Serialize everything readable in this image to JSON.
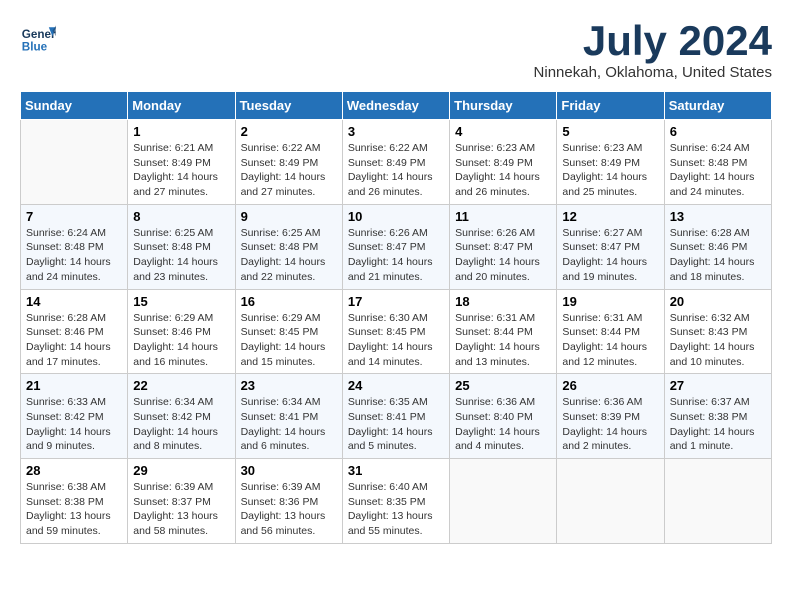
{
  "header": {
    "logo_line1": "General",
    "logo_line2": "Blue",
    "month": "July 2024",
    "location": "Ninnekah, Oklahoma, United States"
  },
  "weekdays": [
    "Sunday",
    "Monday",
    "Tuesday",
    "Wednesday",
    "Thursday",
    "Friday",
    "Saturday"
  ],
  "weeks": [
    [
      {
        "day": "",
        "info": ""
      },
      {
        "day": "1",
        "info": "Sunrise: 6:21 AM\nSunset: 8:49 PM\nDaylight: 14 hours\nand 27 minutes."
      },
      {
        "day": "2",
        "info": "Sunrise: 6:22 AM\nSunset: 8:49 PM\nDaylight: 14 hours\nand 27 minutes."
      },
      {
        "day": "3",
        "info": "Sunrise: 6:22 AM\nSunset: 8:49 PM\nDaylight: 14 hours\nand 26 minutes."
      },
      {
        "day": "4",
        "info": "Sunrise: 6:23 AM\nSunset: 8:49 PM\nDaylight: 14 hours\nand 26 minutes."
      },
      {
        "day": "5",
        "info": "Sunrise: 6:23 AM\nSunset: 8:49 PM\nDaylight: 14 hours\nand 25 minutes."
      },
      {
        "day": "6",
        "info": "Sunrise: 6:24 AM\nSunset: 8:48 PM\nDaylight: 14 hours\nand 24 minutes."
      }
    ],
    [
      {
        "day": "7",
        "info": "Sunrise: 6:24 AM\nSunset: 8:48 PM\nDaylight: 14 hours\nand 24 minutes."
      },
      {
        "day": "8",
        "info": "Sunrise: 6:25 AM\nSunset: 8:48 PM\nDaylight: 14 hours\nand 23 minutes."
      },
      {
        "day": "9",
        "info": "Sunrise: 6:25 AM\nSunset: 8:48 PM\nDaylight: 14 hours\nand 22 minutes."
      },
      {
        "day": "10",
        "info": "Sunrise: 6:26 AM\nSunset: 8:47 PM\nDaylight: 14 hours\nand 21 minutes."
      },
      {
        "day": "11",
        "info": "Sunrise: 6:26 AM\nSunset: 8:47 PM\nDaylight: 14 hours\nand 20 minutes."
      },
      {
        "day": "12",
        "info": "Sunrise: 6:27 AM\nSunset: 8:47 PM\nDaylight: 14 hours\nand 19 minutes."
      },
      {
        "day": "13",
        "info": "Sunrise: 6:28 AM\nSunset: 8:46 PM\nDaylight: 14 hours\nand 18 minutes."
      }
    ],
    [
      {
        "day": "14",
        "info": "Sunrise: 6:28 AM\nSunset: 8:46 PM\nDaylight: 14 hours\nand 17 minutes."
      },
      {
        "day": "15",
        "info": "Sunrise: 6:29 AM\nSunset: 8:46 PM\nDaylight: 14 hours\nand 16 minutes."
      },
      {
        "day": "16",
        "info": "Sunrise: 6:29 AM\nSunset: 8:45 PM\nDaylight: 14 hours\nand 15 minutes."
      },
      {
        "day": "17",
        "info": "Sunrise: 6:30 AM\nSunset: 8:45 PM\nDaylight: 14 hours\nand 14 minutes."
      },
      {
        "day": "18",
        "info": "Sunrise: 6:31 AM\nSunset: 8:44 PM\nDaylight: 14 hours\nand 13 minutes."
      },
      {
        "day": "19",
        "info": "Sunrise: 6:31 AM\nSunset: 8:44 PM\nDaylight: 14 hours\nand 12 minutes."
      },
      {
        "day": "20",
        "info": "Sunrise: 6:32 AM\nSunset: 8:43 PM\nDaylight: 14 hours\nand 10 minutes."
      }
    ],
    [
      {
        "day": "21",
        "info": "Sunrise: 6:33 AM\nSunset: 8:42 PM\nDaylight: 14 hours\nand 9 minutes."
      },
      {
        "day": "22",
        "info": "Sunrise: 6:34 AM\nSunset: 8:42 PM\nDaylight: 14 hours\nand 8 minutes."
      },
      {
        "day": "23",
        "info": "Sunrise: 6:34 AM\nSunset: 8:41 PM\nDaylight: 14 hours\nand 6 minutes."
      },
      {
        "day": "24",
        "info": "Sunrise: 6:35 AM\nSunset: 8:41 PM\nDaylight: 14 hours\nand 5 minutes."
      },
      {
        "day": "25",
        "info": "Sunrise: 6:36 AM\nSunset: 8:40 PM\nDaylight: 14 hours\nand 4 minutes."
      },
      {
        "day": "26",
        "info": "Sunrise: 6:36 AM\nSunset: 8:39 PM\nDaylight: 14 hours\nand 2 minutes."
      },
      {
        "day": "27",
        "info": "Sunrise: 6:37 AM\nSunset: 8:38 PM\nDaylight: 14 hours\nand 1 minute."
      }
    ],
    [
      {
        "day": "28",
        "info": "Sunrise: 6:38 AM\nSunset: 8:38 PM\nDaylight: 13 hours\nand 59 minutes."
      },
      {
        "day": "29",
        "info": "Sunrise: 6:39 AM\nSunset: 8:37 PM\nDaylight: 13 hours\nand 58 minutes."
      },
      {
        "day": "30",
        "info": "Sunrise: 6:39 AM\nSunset: 8:36 PM\nDaylight: 13 hours\nand 56 minutes."
      },
      {
        "day": "31",
        "info": "Sunrise: 6:40 AM\nSunset: 8:35 PM\nDaylight: 13 hours\nand 55 minutes."
      },
      {
        "day": "",
        "info": ""
      },
      {
        "day": "",
        "info": ""
      },
      {
        "day": "",
        "info": ""
      }
    ]
  ]
}
